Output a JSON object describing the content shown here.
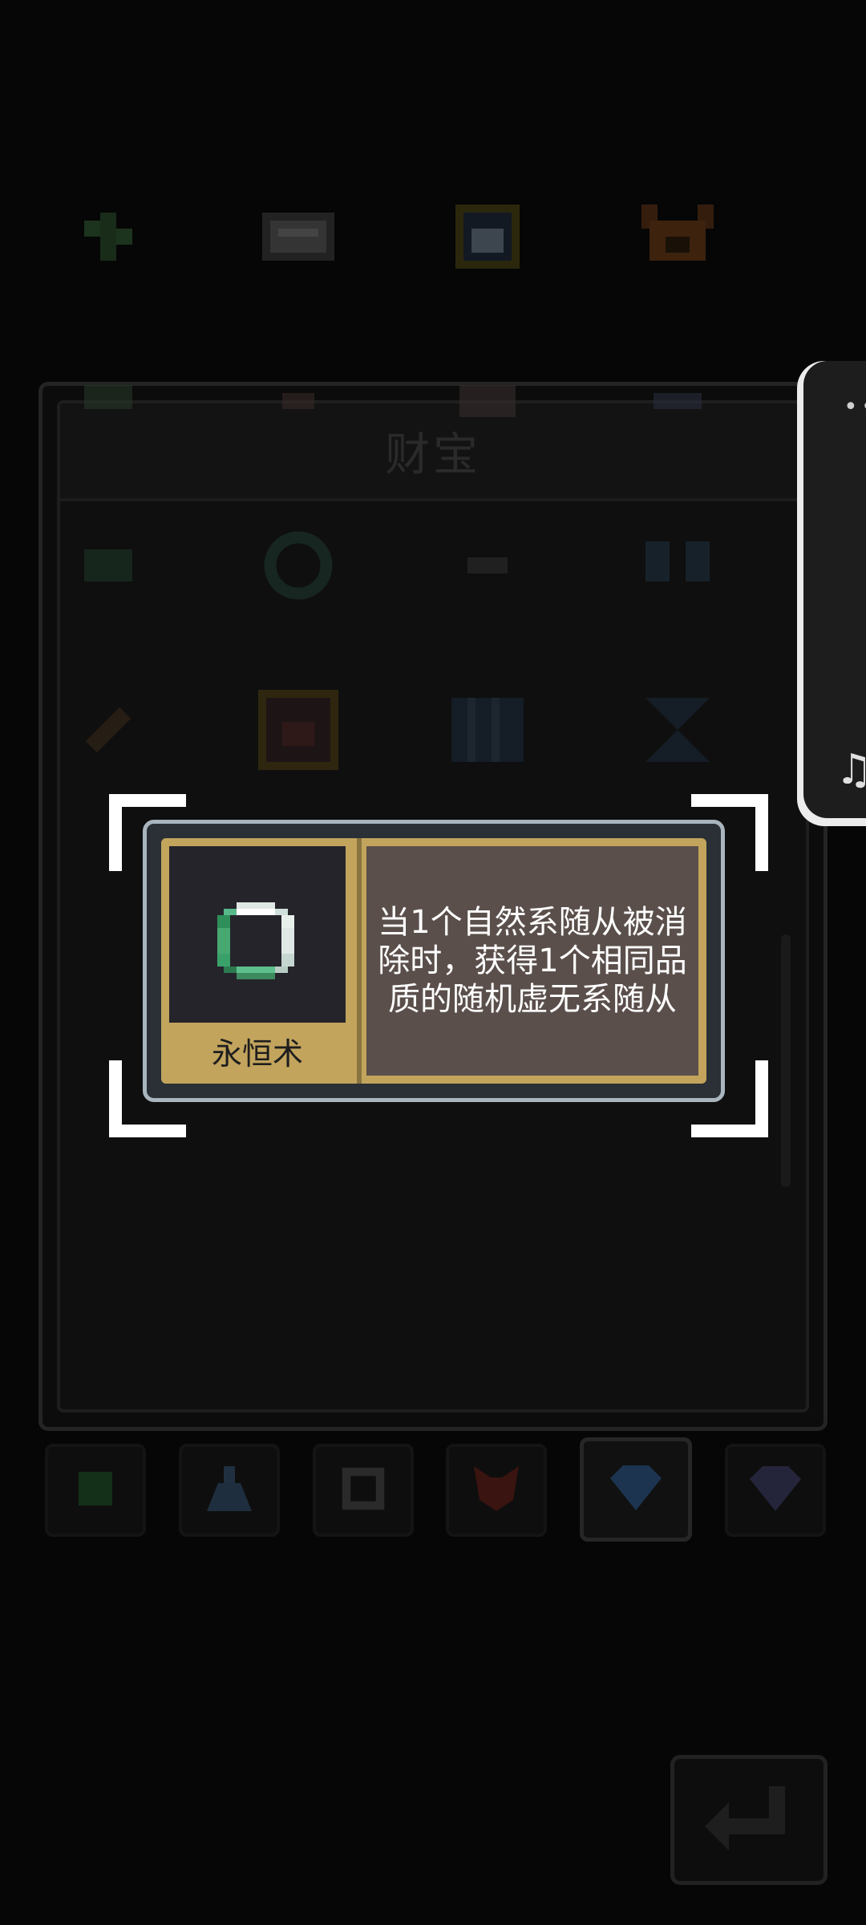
{
  "panel": {
    "title": "财宝"
  },
  "grid_icons": [
    [
      "leaf-sprout-icon",
      "chest-icon",
      "crown-shield-icon",
      "fox-mask-icon"
    ],
    [
      "bone-icon",
      "dagger-icon",
      "scroll-icon",
      "wind-icon"
    ],
    [
      "ring-icon",
      "ring-icon",
      "knife-icon",
      "butterfly-icon"
    ],
    [
      "flute-icon",
      "treasure-chest-icon",
      "book-icon",
      "hourglass-icon"
    ]
  ],
  "tabs": [
    "clover-icon",
    "flask-icon",
    "bone-cross-icon",
    "fox-icon",
    "gem-icon",
    "gem-icon"
  ],
  "active_tab": 4,
  "tooltip": {
    "item_name": "永恒术",
    "description": "当1个自然系随从被消除时，获得1个相同品质的随机虚无系随从",
    "icon": "jade-ring-icon"
  },
  "colors": {
    "tooltip_frame": "#a9b5be",
    "tooltip_gold": "#c2a45c",
    "tooltip_desc_bg": "#5a4f4b",
    "icon_bg": "#25242b"
  }
}
